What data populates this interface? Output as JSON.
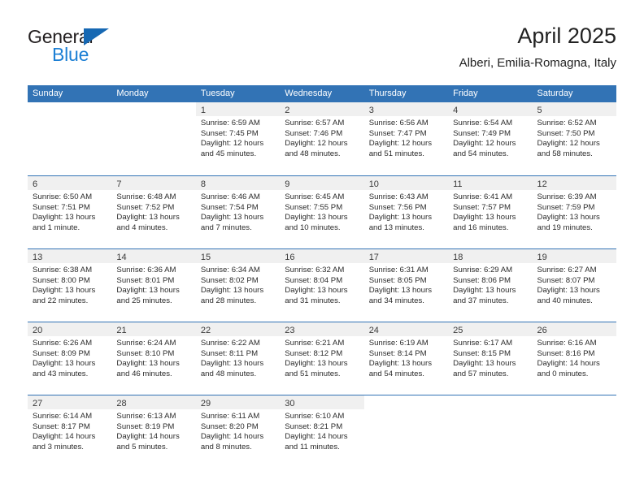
{
  "brand": {
    "name_top": "General",
    "name_bottom": "Blue",
    "triangle_color": "#1668b3",
    "blue_color": "#1c7fd4"
  },
  "header": {
    "month_title": "April 2025",
    "location": "Alberi, Emilia-Romagna, Italy"
  },
  "colors": {
    "header_band": "#3273b5",
    "daynum_strip": "#f0f0f0",
    "row_divider": "#3273b5",
    "text": "#2b2b2b"
  },
  "weekdays": [
    "Sunday",
    "Monday",
    "Tuesday",
    "Wednesday",
    "Thursday",
    "Friday",
    "Saturday"
  ],
  "weeks": [
    [
      {
        "day": "",
        "sunrise": "",
        "sunset": "",
        "daylight": ""
      },
      {
        "day": "",
        "sunrise": "",
        "sunset": "",
        "daylight": ""
      },
      {
        "day": "1",
        "sunrise": "Sunrise: 6:59 AM",
        "sunset": "Sunset: 7:45 PM",
        "daylight": "Daylight: 12 hours and 45 minutes."
      },
      {
        "day": "2",
        "sunrise": "Sunrise: 6:57 AM",
        "sunset": "Sunset: 7:46 PM",
        "daylight": "Daylight: 12 hours and 48 minutes."
      },
      {
        "day": "3",
        "sunrise": "Sunrise: 6:56 AM",
        "sunset": "Sunset: 7:47 PM",
        "daylight": "Daylight: 12 hours and 51 minutes."
      },
      {
        "day": "4",
        "sunrise": "Sunrise: 6:54 AM",
        "sunset": "Sunset: 7:49 PM",
        "daylight": "Daylight: 12 hours and 54 minutes."
      },
      {
        "day": "5",
        "sunrise": "Sunrise: 6:52 AM",
        "sunset": "Sunset: 7:50 PM",
        "daylight": "Daylight: 12 hours and 58 minutes."
      }
    ],
    [
      {
        "day": "6",
        "sunrise": "Sunrise: 6:50 AM",
        "sunset": "Sunset: 7:51 PM",
        "daylight": "Daylight: 13 hours and 1 minute."
      },
      {
        "day": "7",
        "sunrise": "Sunrise: 6:48 AM",
        "sunset": "Sunset: 7:52 PM",
        "daylight": "Daylight: 13 hours and 4 minutes."
      },
      {
        "day": "8",
        "sunrise": "Sunrise: 6:46 AM",
        "sunset": "Sunset: 7:54 PM",
        "daylight": "Daylight: 13 hours and 7 minutes."
      },
      {
        "day": "9",
        "sunrise": "Sunrise: 6:45 AM",
        "sunset": "Sunset: 7:55 PM",
        "daylight": "Daylight: 13 hours and 10 minutes."
      },
      {
        "day": "10",
        "sunrise": "Sunrise: 6:43 AM",
        "sunset": "Sunset: 7:56 PM",
        "daylight": "Daylight: 13 hours and 13 minutes."
      },
      {
        "day": "11",
        "sunrise": "Sunrise: 6:41 AM",
        "sunset": "Sunset: 7:57 PM",
        "daylight": "Daylight: 13 hours and 16 minutes."
      },
      {
        "day": "12",
        "sunrise": "Sunrise: 6:39 AM",
        "sunset": "Sunset: 7:59 PM",
        "daylight": "Daylight: 13 hours and 19 minutes."
      }
    ],
    [
      {
        "day": "13",
        "sunrise": "Sunrise: 6:38 AM",
        "sunset": "Sunset: 8:00 PM",
        "daylight": "Daylight: 13 hours and 22 minutes."
      },
      {
        "day": "14",
        "sunrise": "Sunrise: 6:36 AM",
        "sunset": "Sunset: 8:01 PM",
        "daylight": "Daylight: 13 hours and 25 minutes."
      },
      {
        "day": "15",
        "sunrise": "Sunrise: 6:34 AM",
        "sunset": "Sunset: 8:02 PM",
        "daylight": "Daylight: 13 hours and 28 minutes."
      },
      {
        "day": "16",
        "sunrise": "Sunrise: 6:32 AM",
        "sunset": "Sunset: 8:04 PM",
        "daylight": "Daylight: 13 hours and 31 minutes."
      },
      {
        "day": "17",
        "sunrise": "Sunrise: 6:31 AM",
        "sunset": "Sunset: 8:05 PM",
        "daylight": "Daylight: 13 hours and 34 minutes."
      },
      {
        "day": "18",
        "sunrise": "Sunrise: 6:29 AM",
        "sunset": "Sunset: 8:06 PM",
        "daylight": "Daylight: 13 hours and 37 minutes."
      },
      {
        "day": "19",
        "sunrise": "Sunrise: 6:27 AM",
        "sunset": "Sunset: 8:07 PM",
        "daylight": "Daylight: 13 hours and 40 minutes."
      }
    ],
    [
      {
        "day": "20",
        "sunrise": "Sunrise: 6:26 AM",
        "sunset": "Sunset: 8:09 PM",
        "daylight": "Daylight: 13 hours and 43 minutes."
      },
      {
        "day": "21",
        "sunrise": "Sunrise: 6:24 AM",
        "sunset": "Sunset: 8:10 PM",
        "daylight": "Daylight: 13 hours and 46 minutes."
      },
      {
        "day": "22",
        "sunrise": "Sunrise: 6:22 AM",
        "sunset": "Sunset: 8:11 PM",
        "daylight": "Daylight: 13 hours and 48 minutes."
      },
      {
        "day": "23",
        "sunrise": "Sunrise: 6:21 AM",
        "sunset": "Sunset: 8:12 PM",
        "daylight": "Daylight: 13 hours and 51 minutes."
      },
      {
        "day": "24",
        "sunrise": "Sunrise: 6:19 AM",
        "sunset": "Sunset: 8:14 PM",
        "daylight": "Daylight: 13 hours and 54 minutes."
      },
      {
        "day": "25",
        "sunrise": "Sunrise: 6:17 AM",
        "sunset": "Sunset: 8:15 PM",
        "daylight": "Daylight: 13 hours and 57 minutes."
      },
      {
        "day": "26",
        "sunrise": "Sunrise: 6:16 AM",
        "sunset": "Sunset: 8:16 PM",
        "daylight": "Daylight: 14 hours and 0 minutes."
      }
    ],
    [
      {
        "day": "27",
        "sunrise": "Sunrise: 6:14 AM",
        "sunset": "Sunset: 8:17 PM",
        "daylight": "Daylight: 14 hours and 3 minutes."
      },
      {
        "day": "28",
        "sunrise": "Sunrise: 6:13 AM",
        "sunset": "Sunset: 8:19 PM",
        "daylight": "Daylight: 14 hours and 5 minutes."
      },
      {
        "day": "29",
        "sunrise": "Sunrise: 6:11 AM",
        "sunset": "Sunset: 8:20 PM",
        "daylight": "Daylight: 14 hours and 8 minutes."
      },
      {
        "day": "30",
        "sunrise": "Sunrise: 6:10 AM",
        "sunset": "Sunset: 8:21 PM",
        "daylight": "Daylight: 14 hours and 11 minutes."
      },
      {
        "day": "",
        "sunrise": "",
        "sunset": "",
        "daylight": ""
      },
      {
        "day": "",
        "sunrise": "",
        "sunset": "",
        "daylight": ""
      },
      {
        "day": "",
        "sunrise": "",
        "sunset": "",
        "daylight": ""
      }
    ]
  ]
}
